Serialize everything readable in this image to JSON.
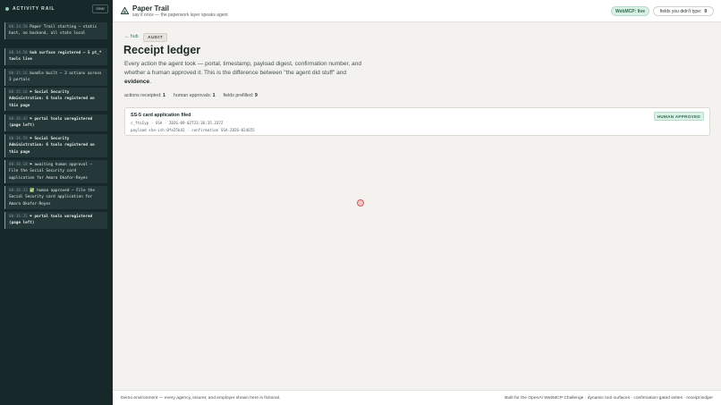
{
  "rail": {
    "title": "ACTIVITY RAIL",
    "clear_label": "clear",
    "entries": [
      {
        "time": "00:34:58",
        "text": "Paper Trail starting — static host, no backend, all state local"
      },
      {
        "time": "00:34:58",
        "text": "hub surface registered — 5 pt_* tools live"
      },
      {
        "time": "00:35:16",
        "text": "bundle built — 3 actions across 3 portals"
      },
      {
        "time": "00:35:16",
        "text": "⚑ Social Security Administration: 6 tools registered on this page"
      },
      {
        "time": "00:36:42",
        "text": "⚑ portal tools unregistered (page left)"
      },
      {
        "time": "00:36:59",
        "text": "⚑ Social Security Administration: 6 tools registered on this page"
      },
      {
        "time": "00:36:18",
        "text": "⚑ awaiting human approval — File the Social Security card application for Amara Okafor-Reyes"
      },
      {
        "time": "00:36:33",
        "text": "✅ human approved — File the Social Security card application for Amara Okafor-Reyes"
      },
      {
        "time": "00:36:35",
        "text": "⚑ portal tools unregistered (page left)"
      }
    ]
  },
  "header": {
    "app_name": "Paper Trail",
    "tagline": "say it once — the paperwork layer speaks agent",
    "live_badge": "WebMCP: live",
    "fields_label": "fields you didn't type:",
    "fields_value": "9"
  },
  "main": {
    "back_link": "← hub",
    "audit_badge": "AUDIT",
    "title": "Receipt ledger",
    "lede_part1": "Every action the agent took — portal, timestamp, payload digest, confirmation number, and whether a human approved it. This is the difference between \"the agent did stuff\" and ",
    "lede_bold": "evidence",
    "lede_end": ".",
    "stats": {
      "receipted_label": "actions receipted:",
      "receipted_value": "1",
      "approvals_label": "human approvals:",
      "approvals_value": "1",
      "prefilled_label": "fields prefilled:",
      "prefilled_value": "9"
    },
    "receipt": {
      "title": "SS-5 card application filed",
      "meta": "c_ftoIyp · SSA · 2026-09-02T23:36:35.337Z",
      "hash": "payload sha-ish:0fe25b42 · confirmation SSA-2026-024655",
      "status": "HUMAN APPROVED"
    }
  },
  "footer": {
    "left": "Demo environment — every agency, insurer, and employer shown here is fictional.",
    "right": "Built for the OpenAI WebMCP Challenge · dynamic tool surfaces · confirmation-gated writes · receipt ledger"
  },
  "colors": {
    "rail_bg": "#17282a",
    "accent_green": "#5fb59a",
    "warn_amber": "#d9a24a",
    "badge_green_bg": "#dcf1e6"
  }
}
